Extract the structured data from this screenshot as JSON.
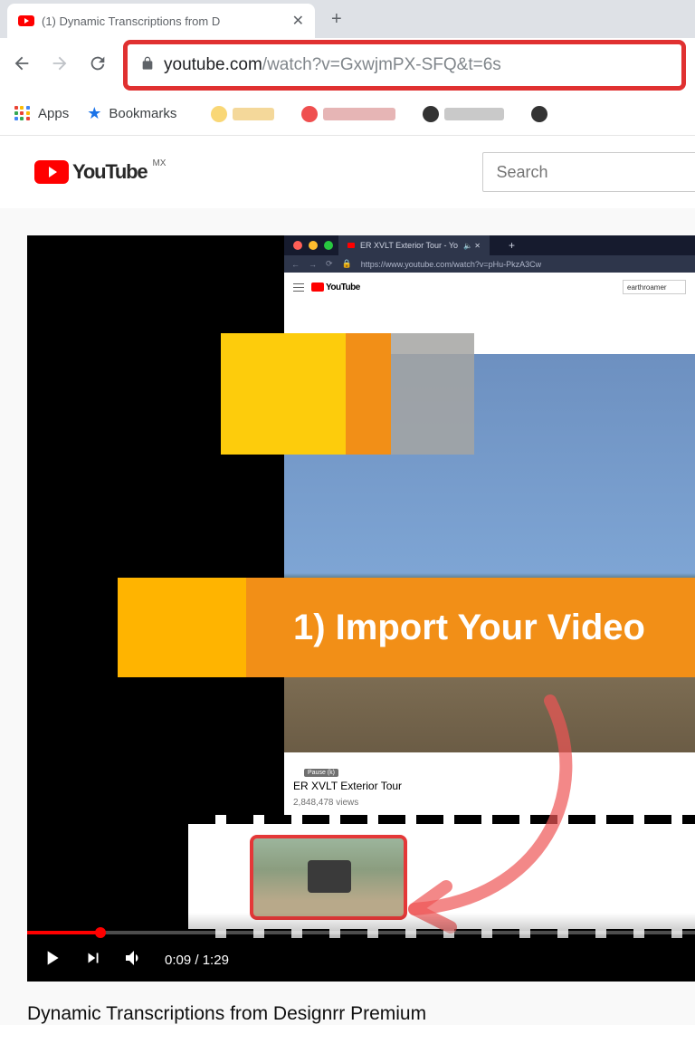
{
  "browser": {
    "tab_title": "(1) Dynamic Transcriptions from D",
    "url_domain": "youtube.com",
    "url_path": "/watch?v=GxwjmPX-SFQ&t=6s",
    "apps_label": "Apps",
    "bookmarks_label": "Bookmarks"
  },
  "yt_header": {
    "logo_text": "YouTube",
    "region": "MX",
    "search_placeholder": "Search"
  },
  "player": {
    "current_time": "0:09",
    "duration": "1:29"
  },
  "overlay": {
    "text": "1) Import Your Video"
  },
  "inner": {
    "tab_title": "ER XVLT Exterior Tour - Yo",
    "url": "https://www.youtube.com/watch?v=pHu-PkzA3Cw",
    "logo_text": "YouTube",
    "search_value": "earthroamer",
    "pause_tooltip": "Pause (k)",
    "video_title": "ER XVLT Exterior Tour",
    "views": "2,848,478 views"
  },
  "video_title": "Dynamic Transcriptions from Designrr Premium"
}
